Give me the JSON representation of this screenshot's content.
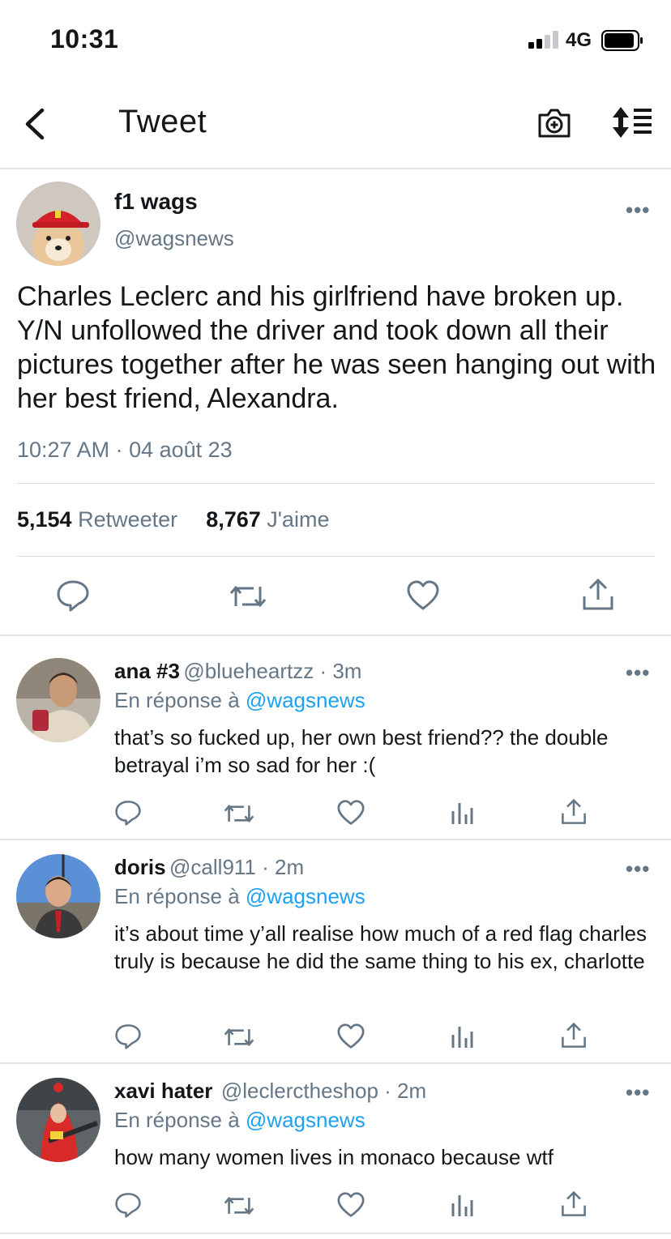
{
  "status_bar": {
    "time": "10:31",
    "network": "4G"
  },
  "nav": {
    "title": "Tweet"
  },
  "main_tweet": {
    "name": "f1 wags",
    "handle": "@wagsnews",
    "more": "•••",
    "text": "Charles Leclerc and his girlfriend have broken up. Y/N unfollowed the driver and took down all their pictures together after he was seen hanging out with her best friend, Alexandra.",
    "timestamp": "10:27 AM · 04 août 23",
    "retweets_count": "5,154",
    "retweets_label": "Retweeter",
    "likes_count": "8,767",
    "likes_label": "J'aime"
  },
  "replies": [
    {
      "name": "ana #3",
      "handle": "@blueheartzz · 3m",
      "reply_prefix": "En réponse à",
      "reply_to": "@wagsnews",
      "text": "that’s so fucked up, her own best friend?? the double betrayal i’m so sad for her :(",
      "more": "•••"
    },
    {
      "name": "doris",
      "handle": "@call911 · 2m",
      "reply_prefix": "En réponse à",
      "reply_to": "@wagsnews",
      "text": "it’s about time y’all realise how much of a red flag charles truly is because he did the same thing to his ex, charlotte",
      "more": "•••"
    },
    {
      "name": "xavi hater",
      "handle": "@leclerctheshop · 2m",
      "reply_prefix": "En réponse à",
      "reply_to": "@wagsnews",
      "text": "how many women lives in monaco because wtf",
      "more": "•••"
    }
  ],
  "icons": {
    "back": "chevron-left-icon",
    "camera": "camera-plus-icon",
    "sort": "sort-icon",
    "reply": "reply-icon",
    "retweet": "retweet-icon",
    "like": "heart-icon",
    "analytics": "analytics-icon",
    "share": "share-icon"
  },
  "colors": {
    "link": "#1da1f2",
    "secondary_text": "#657786",
    "primary_text": "#14171a"
  }
}
